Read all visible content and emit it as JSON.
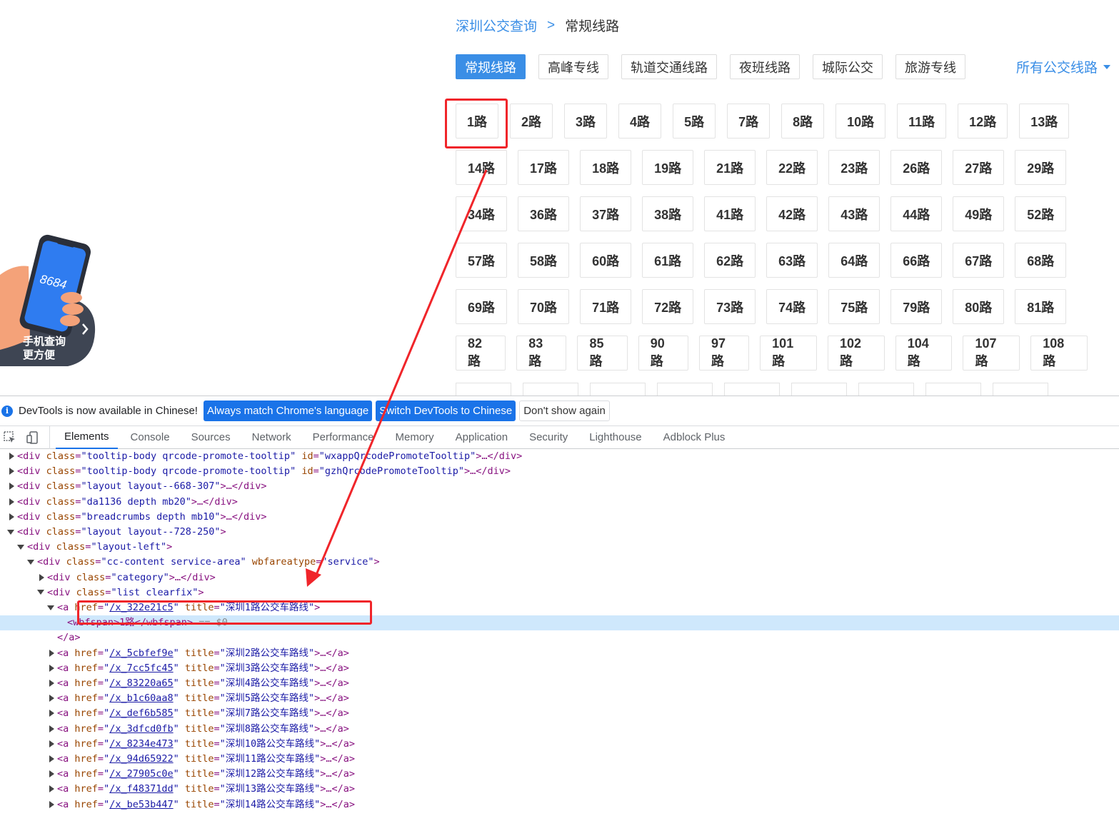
{
  "breadcrumb": {
    "home": "深圳公交查询",
    "separator": ">",
    "current": "常规线路"
  },
  "category_tabs": [
    "常规线路",
    "高峰专线",
    "轨道交通线路",
    "夜班线路",
    "城际公交",
    "旅游专线"
  ],
  "all_lines_link": "所有公交线路",
  "routes": [
    [
      "1路",
      "2路",
      "3路",
      "4路",
      "5路",
      "7路",
      "8路",
      "10路",
      "11路",
      "12路",
      "13路"
    ],
    [
      "14路",
      "17路",
      "18路",
      "19路",
      "21路",
      "22路",
      "23路",
      "26路",
      "27路",
      "29路"
    ],
    [
      "34路",
      "36路",
      "37路",
      "38路",
      "41路",
      "42路",
      "43路",
      "44路",
      "49路",
      "52路"
    ],
    [
      "57路",
      "58路",
      "60路",
      "61路",
      "62路",
      "63路",
      "64路",
      "66路",
      "67路",
      "68路"
    ],
    [
      "69路",
      "70路",
      "71路",
      "72路",
      "73路",
      "74路",
      "75路",
      "79路",
      "80路",
      "81路"
    ],
    [
      "82路",
      "83路",
      "85路",
      "90路",
      "97路",
      "101路",
      "102路",
      "104路",
      "107路",
      "108路"
    ]
  ],
  "promo": {
    "line1": "手机查询",
    "line2": "更方便",
    "phone_digits": "8684"
  },
  "devtools": {
    "infobar": {
      "message": "DevTools is now available in Chinese!",
      "btn_match": "Always match Chrome's language",
      "btn_switch": "Switch DevTools to Chinese",
      "btn_dismiss": "Don't show again"
    },
    "tabs": [
      "Elements",
      "Console",
      "Sources",
      "Network",
      "Performance",
      "Memory",
      "Application",
      "Security",
      "Lighthouse",
      "Adblock Plus"
    ],
    "selected_suffix": " == $0",
    "dom_lines": [
      {
        "indent": 0,
        "toggle": "collapsed",
        "tag": "div",
        "attrs": [
          [
            "class",
            "tooltip-body qrcode-promote-tooltip"
          ],
          [
            "id",
            "wxappQrcodePromoteTooltip"
          ]
        ],
        "tail": ">…</div>"
      },
      {
        "indent": 0,
        "toggle": "collapsed",
        "tag": "div",
        "attrs": [
          [
            "class",
            "tooltip-body qrcode-promote-tooltip"
          ],
          [
            "id",
            "gzhQrcodePromoteTooltip"
          ]
        ],
        "tail": ">…</div>"
      },
      {
        "indent": 0,
        "toggle": "collapsed",
        "tag": "div",
        "attrs": [
          [
            "class",
            "layout layout--668-307"
          ]
        ],
        "tail": ">…</div>"
      },
      {
        "indent": 0,
        "toggle": "collapsed",
        "tag": "div",
        "attrs": [
          [
            "class",
            "da1136 depth mb20"
          ]
        ],
        "tail": ">…</div>"
      },
      {
        "indent": 0,
        "toggle": "collapsed",
        "tag": "div",
        "attrs": [
          [
            "class",
            "breadcrumbs depth mb10"
          ]
        ],
        "tail": ">…</div>"
      },
      {
        "indent": 0,
        "toggle": "expanded",
        "tag": "div",
        "attrs": [
          [
            "class",
            "layout layout--728-250"
          ]
        ],
        "tail": ">"
      },
      {
        "indent": 1,
        "toggle": "expanded",
        "tag": "div",
        "attrs": [
          [
            "class",
            "layout-left"
          ]
        ],
        "tail": ">"
      },
      {
        "indent": 2,
        "toggle": "expanded",
        "tag": "div",
        "attrs": [
          [
            "class",
            "cc-content service-area"
          ],
          [
            "wbfareatype",
            "service"
          ]
        ],
        "tail": ">"
      },
      {
        "indent": 3,
        "toggle": "collapsed",
        "tag": "div",
        "attrs": [
          [
            "class",
            "category"
          ]
        ],
        "tail": ">…</div>"
      },
      {
        "indent": 3,
        "toggle": "expanded",
        "tag": "div",
        "attrs": [
          [
            "class",
            "list clearfix"
          ]
        ],
        "tail": ">"
      },
      {
        "indent": 4,
        "toggle": "expanded",
        "tag": "a",
        "attrs": [
          [
            "href",
            "/x_322e21c5"
          ],
          [
            "title",
            "深圳1路公交车路线"
          ]
        ],
        "tail": ">"
      },
      {
        "indent": 5,
        "toggle": "",
        "raw": "<wbfspan>1路</wbfspan>",
        "selected": true
      },
      {
        "indent": 4,
        "toggle": "",
        "raw": "</a>"
      },
      {
        "indent": 4,
        "toggle": "collapsed",
        "tag": "a",
        "attrs": [
          [
            "href",
            "/x_5cbfef9e"
          ],
          [
            "title",
            "深圳2路公交车路线"
          ]
        ],
        "tail": ">…</a>"
      },
      {
        "indent": 4,
        "toggle": "collapsed",
        "tag": "a",
        "attrs": [
          [
            "href",
            "/x_7cc5fc45"
          ],
          [
            "title",
            "深圳3路公交车路线"
          ]
        ],
        "tail": ">…</a>"
      },
      {
        "indent": 4,
        "toggle": "collapsed",
        "tag": "a",
        "attrs": [
          [
            "href",
            "/x_83220a65"
          ],
          [
            "title",
            "深圳4路公交车路线"
          ]
        ],
        "tail": ">…</a>"
      },
      {
        "indent": 4,
        "toggle": "collapsed",
        "tag": "a",
        "attrs": [
          [
            "href",
            "/x_b1c60aa8"
          ],
          [
            "title",
            "深圳5路公交车路线"
          ]
        ],
        "tail": ">…</a>"
      },
      {
        "indent": 4,
        "toggle": "collapsed",
        "tag": "a",
        "attrs": [
          [
            "href",
            "/x_def6b585"
          ],
          [
            "title",
            "深圳7路公交车路线"
          ]
        ],
        "tail": ">…</a>"
      },
      {
        "indent": 4,
        "toggle": "collapsed",
        "tag": "a",
        "attrs": [
          [
            "href",
            "/x_3dfcd0fb"
          ],
          [
            "title",
            "深圳8路公交车路线"
          ]
        ],
        "tail": ">…</a>"
      },
      {
        "indent": 4,
        "toggle": "collapsed",
        "tag": "a",
        "attrs": [
          [
            "href",
            "/x_8234e473"
          ],
          [
            "title",
            "深圳10路公交车路线"
          ]
        ],
        "tail": ">…</a>"
      },
      {
        "indent": 4,
        "toggle": "collapsed",
        "tag": "a",
        "attrs": [
          [
            "href",
            "/x_94d65922"
          ],
          [
            "title",
            "深圳11路公交车路线"
          ]
        ],
        "tail": ">…</a>"
      },
      {
        "indent": 4,
        "toggle": "collapsed",
        "tag": "a",
        "attrs": [
          [
            "href",
            "/x_27905c0e"
          ],
          [
            "title",
            "深圳12路公交车路线"
          ]
        ],
        "tail": ">…</a>"
      },
      {
        "indent": 4,
        "toggle": "collapsed",
        "tag": "a",
        "attrs": [
          [
            "href",
            "/x_f48371dd"
          ],
          [
            "title",
            "深圳13路公交车路线"
          ]
        ],
        "tail": ">…</a>"
      },
      {
        "indent": 4,
        "toggle": "collapsed",
        "tag": "a",
        "attrs": [
          [
            "href",
            "/x_be53b447"
          ],
          [
            "title",
            "深圳14路公交车路线"
          ]
        ],
        "tail": ">…</a>"
      }
    ]
  },
  "colors": {
    "accent": "#3a8ee6",
    "annotation": "#f0252a",
    "selection": "#cfe8fc"
  }
}
